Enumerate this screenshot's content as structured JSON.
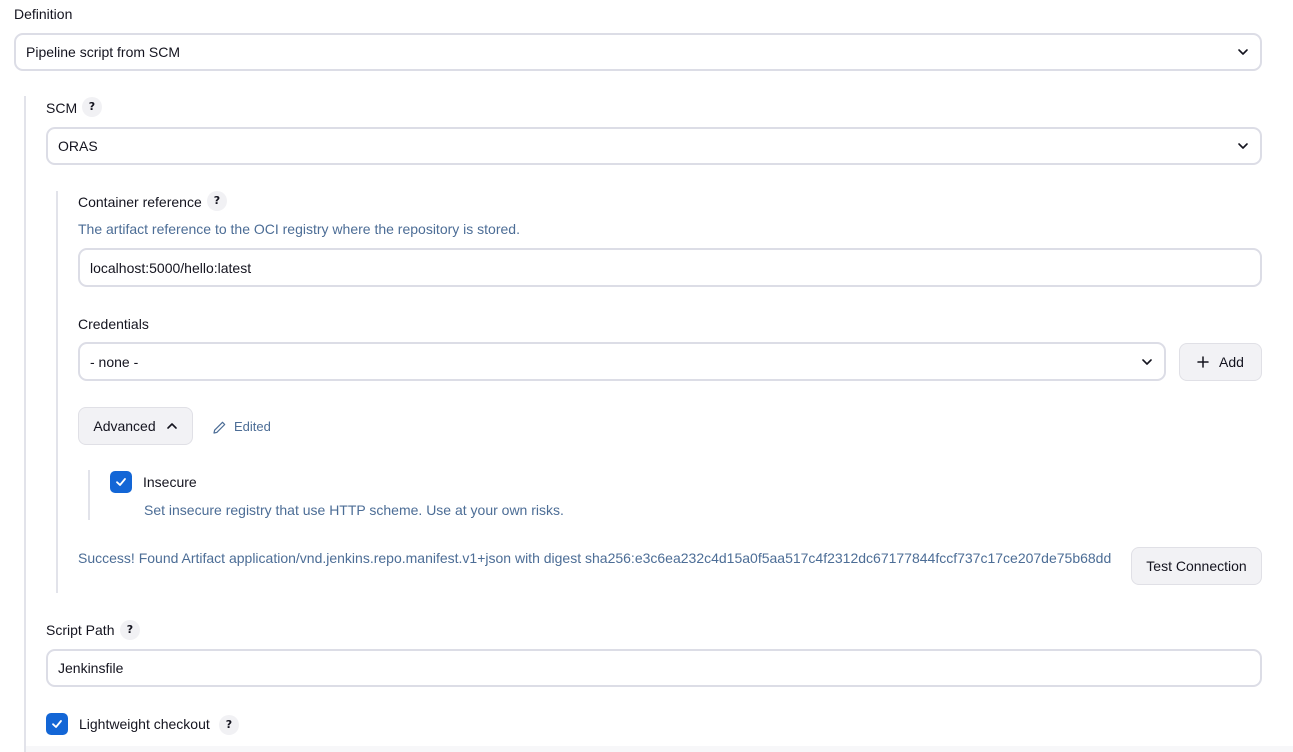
{
  "definition": {
    "label": "Definition",
    "selected": "Pipeline script from SCM"
  },
  "scm": {
    "label": "SCM",
    "help": "?",
    "selected": "ORAS"
  },
  "container_reference": {
    "label": "Container reference",
    "help": "?",
    "description": "The artifact reference to the OCI registry where the repository is stored.",
    "value": "localhost:5000/hello:latest"
  },
  "credentials": {
    "label": "Credentials",
    "selected": "- none -",
    "add_label": "Add"
  },
  "advanced": {
    "label": "Advanced",
    "edited_label": "Edited"
  },
  "insecure": {
    "label": "Insecure",
    "checked": true,
    "description": "Set insecure registry that use HTTP scheme. Use at your own risks."
  },
  "connection": {
    "message": "Success! Found Artifact application/vnd.jenkins.repo.manifest.v1+json with digest sha256:e3c6ea232c4d15a0f5aa517c4f2312dc67177844fccf737c17ce207de75b68dd",
    "test_label": "Test Connection"
  },
  "script_path": {
    "label": "Script Path",
    "help": "?",
    "value": "Jenkinsfile"
  },
  "lightweight": {
    "label": "Lightweight checkout",
    "help": "?",
    "checked": true
  },
  "colors": {
    "accent": "#1366d6",
    "description_text": "#4c6d96",
    "border": "#dcdde6",
    "button_bg": "#f2f2f5"
  }
}
